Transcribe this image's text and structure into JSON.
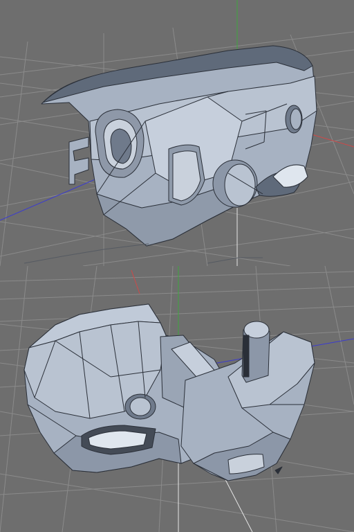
{
  "viewports": [
    {
      "view": "perspective",
      "background_color": "#6e6e6e",
      "grid_color": "#8a8a8a",
      "model_color": "#a7b2c2"
    },
    {
      "view": "perspective",
      "background_color": "#6e6e6e",
      "grid_color": "#8a8a8a",
      "model_color": "#a7b2c2"
    }
  ],
  "axis_colors": {
    "x": "#d04848",
    "y": "#3fa53f",
    "z": "#3b3bd0"
  },
  "icons": [
    "viewport-grid",
    "model-mesh",
    "axis-gizmo"
  ]
}
